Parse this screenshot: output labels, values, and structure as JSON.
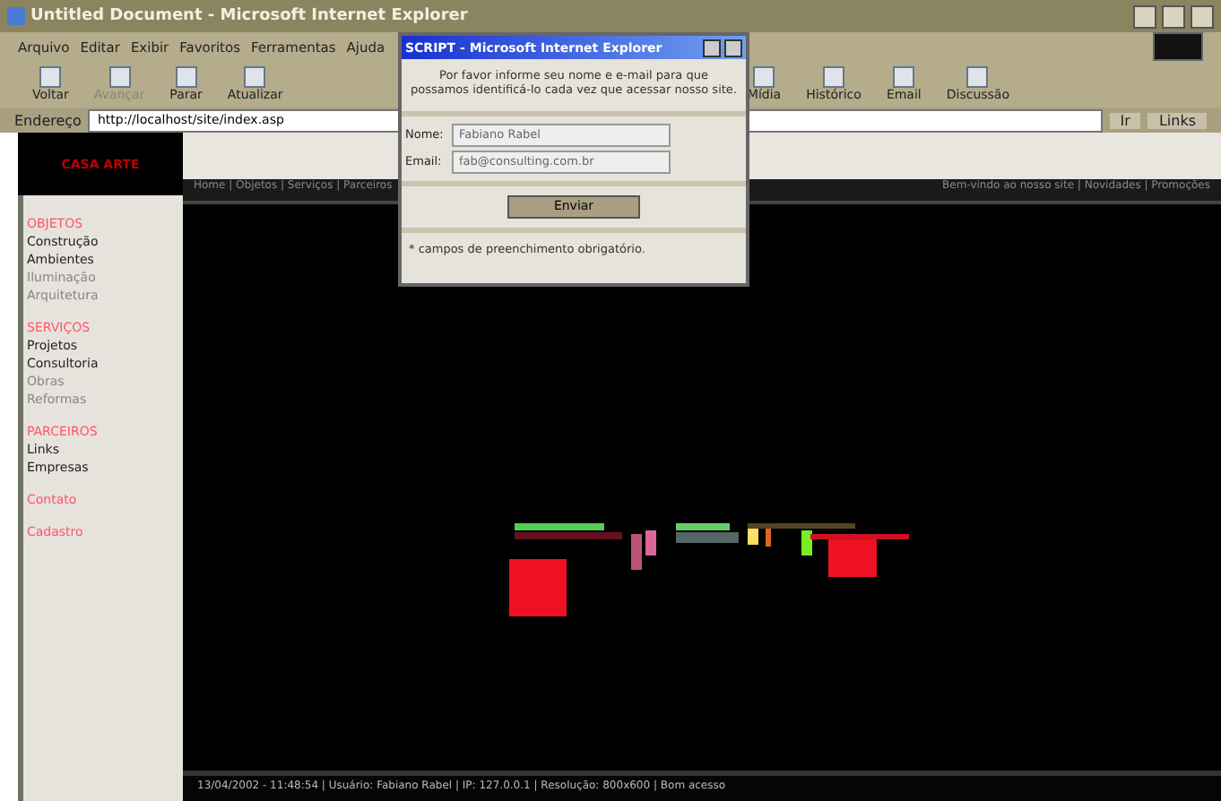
{
  "window": {
    "title": "Untitled Document - Microsoft Internet Explorer"
  },
  "menu": [
    "Arquivo",
    "Editar",
    "Exibir",
    "Favoritos",
    "Ferramentas",
    "Ajuda"
  ],
  "toolbar": [
    {
      "label": "Voltar",
      "disabled": false
    },
    {
      "label": "Avançar",
      "disabled": true
    },
    {
      "label": "Parar",
      "disabled": false
    },
    {
      "label": "Atualizar",
      "disabled": false
    }
  ],
  "toolbar_right": [
    {
      "label": "Mídia",
      "disabled": false
    },
    {
      "label": "Histórico",
      "disabled": false
    },
    {
      "label": "Email",
      "disabled": false
    },
    {
      "label": "Discussão",
      "disabled": false
    }
  ],
  "address": {
    "label": "Endereço",
    "value": "http://localhost/site/index.asp",
    "go": "Ir",
    "links": "Links"
  },
  "site": {
    "logo": "CASA ARTE",
    "nav_left": "Home | Objetos | Serviços | Parceiros",
    "nav_right": "Bem-vindo ao nosso site | Novidades | Promoções",
    "sections": [
      {
        "heading": "OBJETOS",
        "items": [
          {
            "label": "Construção",
            "disabled": false
          },
          {
            "label": "Ambientes",
            "disabled": false
          },
          {
            "label": "Iluminação",
            "disabled": true
          },
          {
            "label": "Arquitetura",
            "disabled": true
          }
        ]
      },
      {
        "heading": "SERVIÇOS",
        "items": [
          {
            "label": "Projetos",
            "disabled": false
          },
          {
            "label": "Consultoria",
            "disabled": false
          },
          {
            "label": "Obras",
            "disabled": true
          },
          {
            "label": "Reformas",
            "disabled": true
          }
        ]
      },
      {
        "heading": "PARCEIROS",
        "items": [
          {
            "label": "Links",
            "disabled": false
          },
          {
            "label": "Empresas",
            "disabled": false
          }
        ]
      },
      {
        "heading": "Contato"
      },
      {
        "heading": "Cadastro"
      }
    ],
    "footer": "13/04/2002 - 11:48:54 | Usuário: Fabiano Rabel | IP: 127.0.0.1 | Resolução: 800x600 | Bom acesso"
  },
  "dialog": {
    "title": "SCRIPT - Microsoft Internet Explorer",
    "message": "Por favor informe seu nome e e-mail para que possamos identificá-lo cada vez que acessar nosso site.",
    "fields": [
      {
        "label": "Nome:",
        "value": "Fabiano Rabel"
      },
      {
        "label": "Email:",
        "value": "fab@consulting.com.br"
      }
    ],
    "button": "Enviar",
    "note": "* campos de preenchimento obrigatório."
  }
}
